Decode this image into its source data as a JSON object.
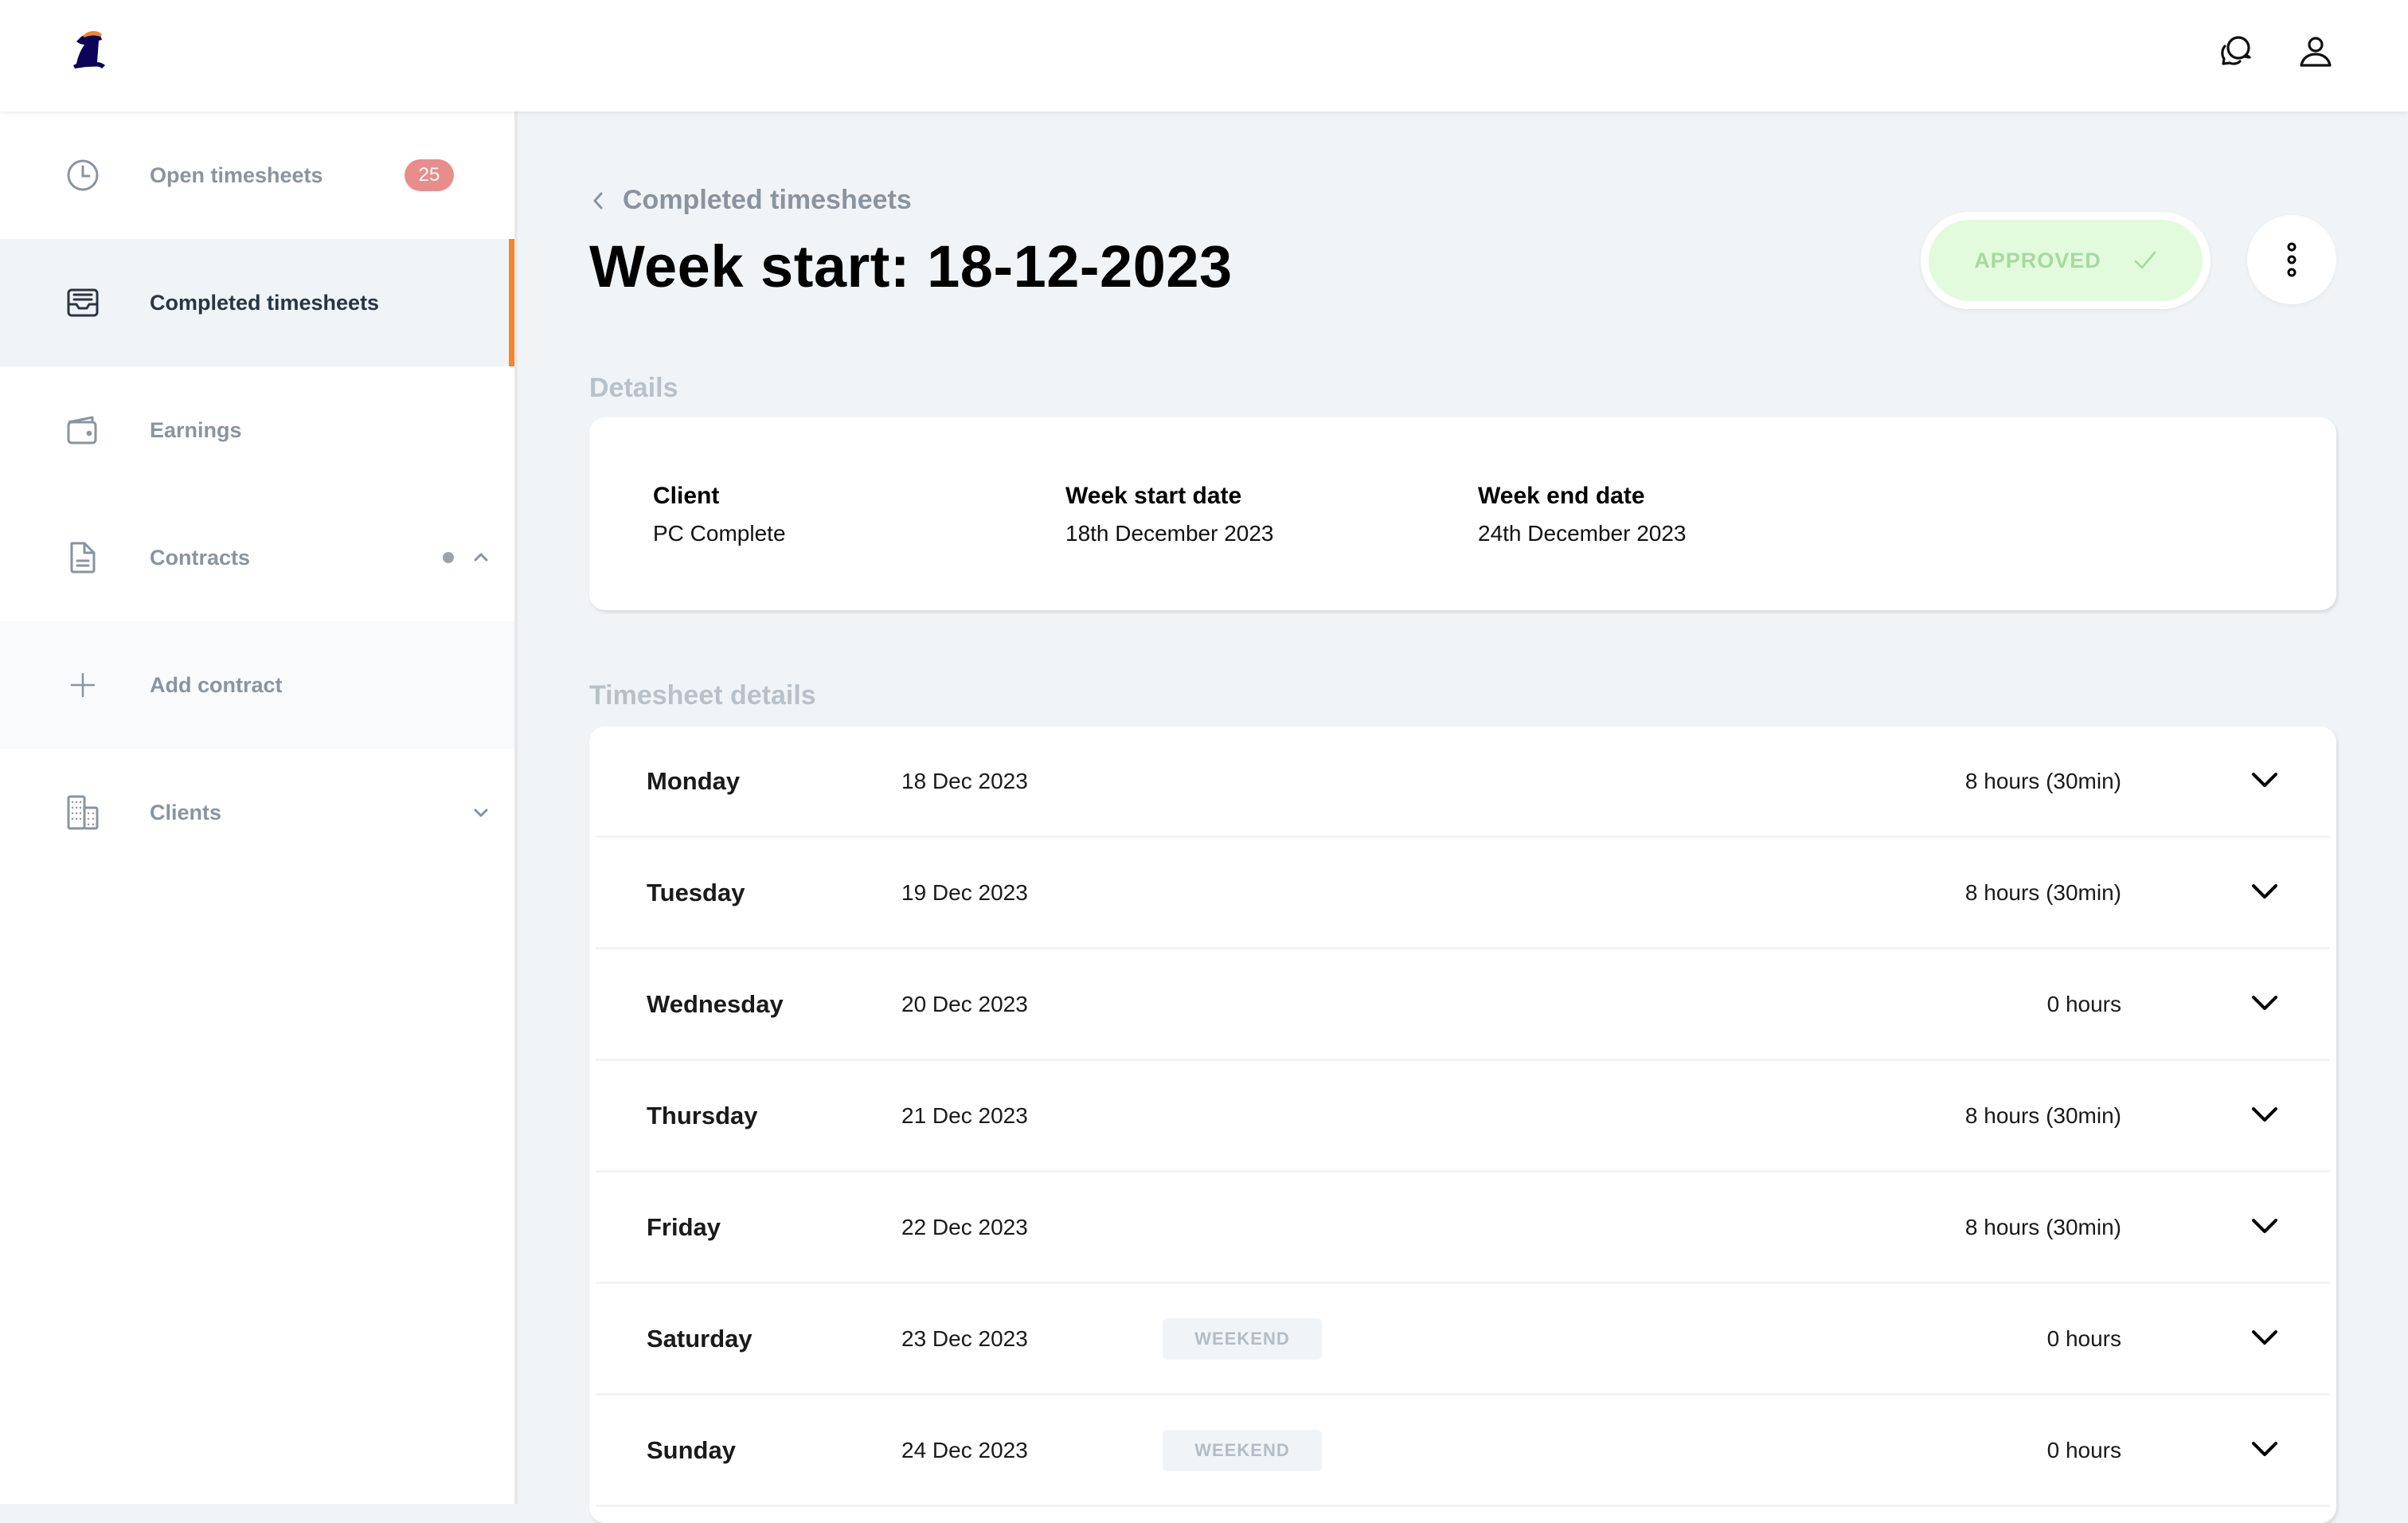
{
  "brand": {
    "logo": "runner-mascot-logo",
    "accent": "#f7842a",
    "logo_primary": "#0b0357"
  },
  "header": {
    "icons": [
      "chat-bubbles-icon",
      "user-profile-icon"
    ]
  },
  "sidebar": {
    "items": [
      {
        "label": "Open timesheets",
        "icon": "clock-icon",
        "badge": "25",
        "active": false
      },
      {
        "label": "Completed timesheets",
        "icon": "inbox-tray-icon",
        "active": true
      },
      {
        "label": "Earnings",
        "icon": "wallet-icon",
        "active": false
      },
      {
        "label": "Contracts",
        "icon": "document-icon",
        "expanded": true,
        "active": false
      },
      {
        "label": "Add contract",
        "icon": "plus-icon",
        "sub_item": true
      },
      {
        "label": "Clients",
        "icon": "buildings-icon",
        "expanded": false,
        "active": false
      }
    ]
  },
  "main": {
    "breadcrumb": "Completed timesheets",
    "title": "Week start: 18-12-2023",
    "status": {
      "label": "APPROVED",
      "color": "#a9d8a3",
      "background": "#e2fbdc"
    },
    "details": {
      "section_title": "Details",
      "fields": [
        {
          "label": "Client",
          "value": "PC Complete"
        },
        {
          "label": "Week start date",
          "value": "18th December 2023"
        },
        {
          "label": "Week end date",
          "value": "24th December 2023"
        }
      ]
    },
    "timesheet": {
      "section_title": "Timesheet details",
      "rows": [
        {
          "day": "Monday",
          "date": "18 Dec 2023",
          "badge": "",
          "hours": "8 hours (30min)"
        },
        {
          "day": "Tuesday",
          "date": "19 Dec 2023",
          "badge": "",
          "hours": "8 hours (30min)"
        },
        {
          "day": "Wednesday",
          "date": "20 Dec 2023",
          "badge": "",
          "hours": "0 hours"
        },
        {
          "day": "Thursday",
          "date": "21 Dec 2023",
          "badge": "",
          "hours": "8 hours (30min)"
        },
        {
          "day": "Friday",
          "date": "22 Dec 2023",
          "badge": "",
          "hours": "8 hours (30min)"
        },
        {
          "day": "Saturday",
          "date": "23 Dec 2023",
          "badge": "WEEKEND",
          "hours": "0 hours"
        },
        {
          "day": "Sunday",
          "date": "24 Dec 2023",
          "badge": "WEEKEND",
          "hours": "0 hours"
        }
      ]
    }
  }
}
